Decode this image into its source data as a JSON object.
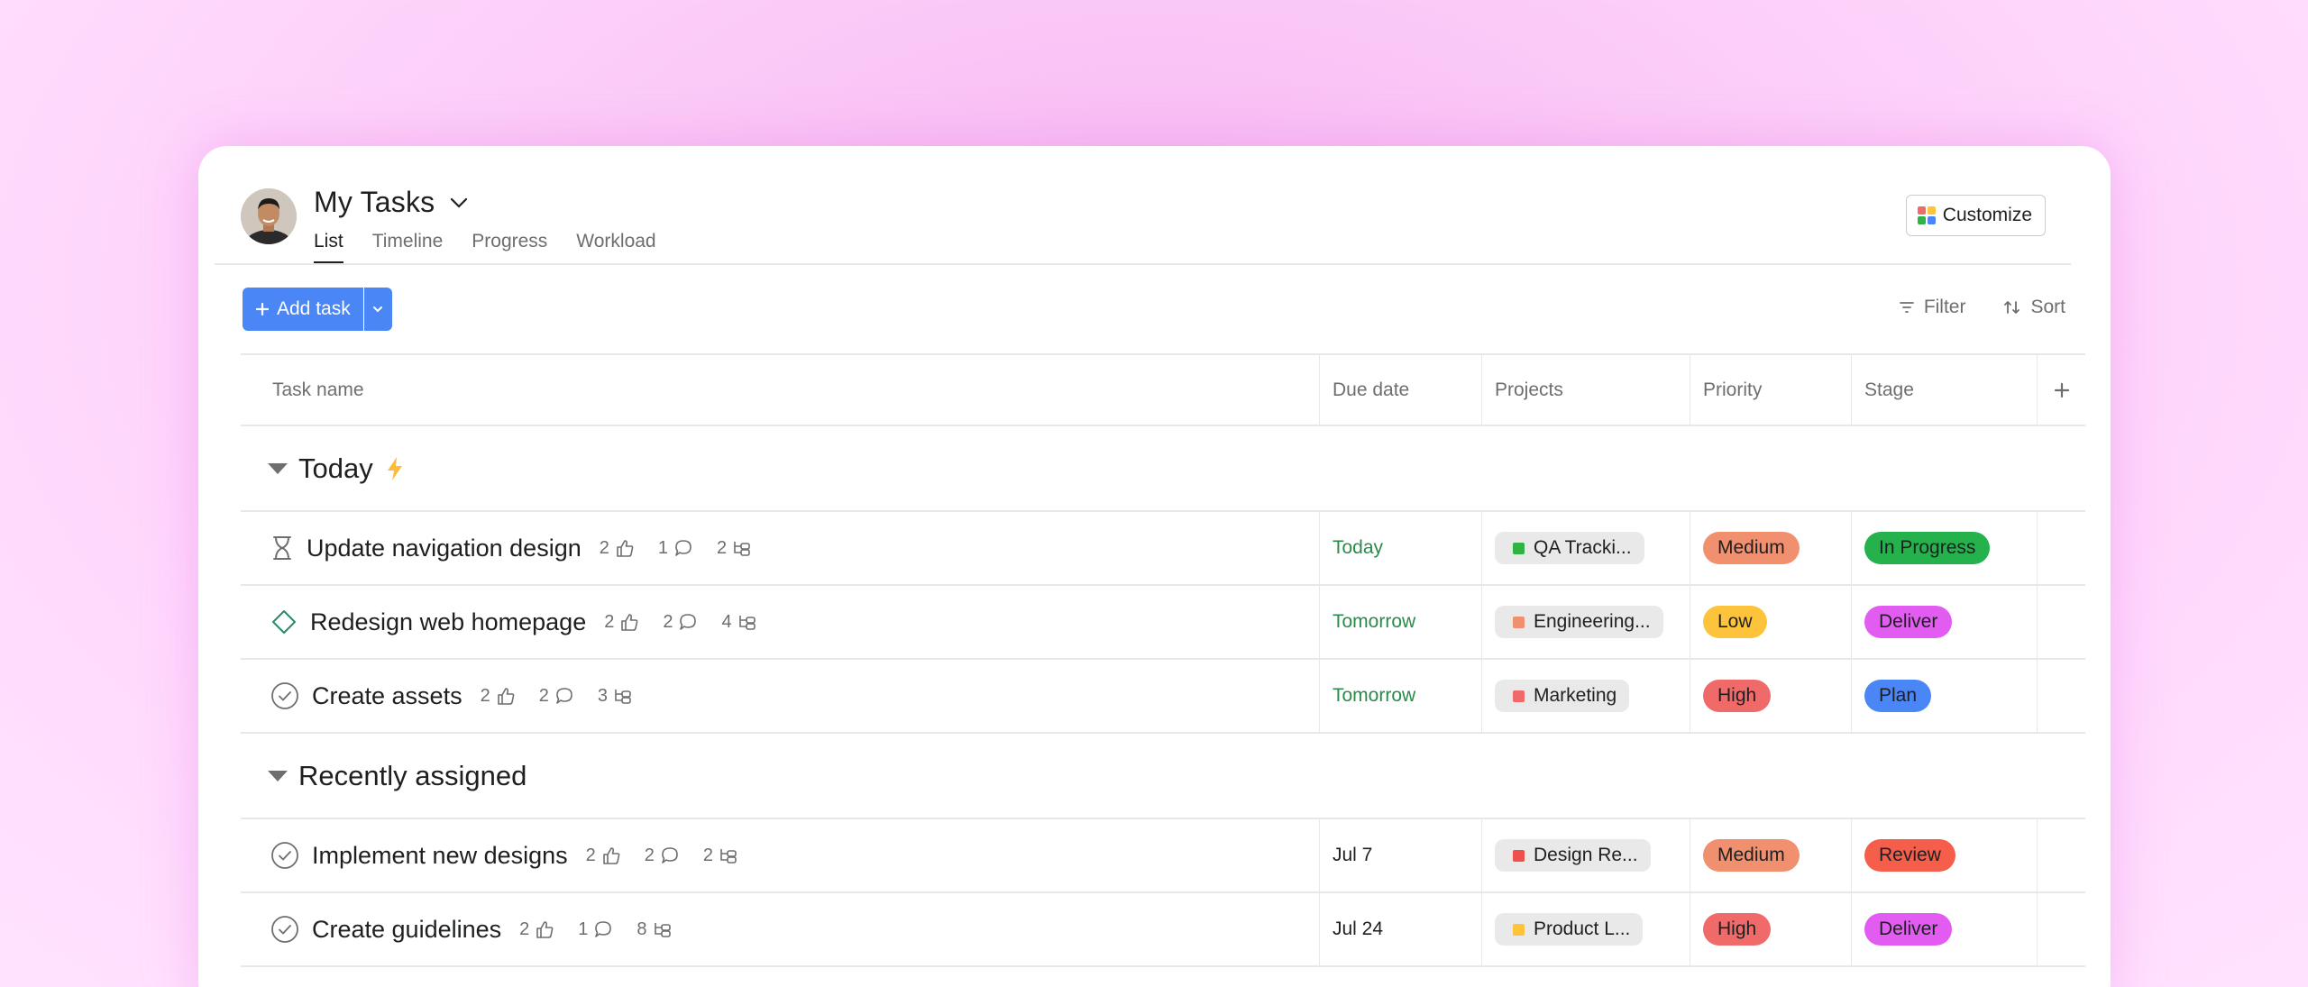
{
  "header": {
    "title": "My Tasks",
    "tabs": [
      {
        "label": "List",
        "active": true
      },
      {
        "label": "Timeline",
        "active": false
      },
      {
        "label": "Progress",
        "active": false
      },
      {
        "label": "Workload",
        "active": false
      }
    ],
    "customize_label": "Customize"
  },
  "toolbar": {
    "add_task_label": "Add task",
    "filter_label": "Filter",
    "sort_label": "Sort"
  },
  "columns": {
    "task_name": "Task name",
    "due_date": "Due date",
    "projects": "Projects",
    "priority": "Priority",
    "stage": "Stage"
  },
  "sections": [
    {
      "label": "Today",
      "icon": "lightning-icon",
      "tasks": [
        {
          "name": "Update navigation design",
          "status_icon": "hourglass-icon",
          "likes": "2",
          "comments": "1",
          "subtasks": "2",
          "due": "Today",
          "due_color": "#2a8a4a",
          "project": "QA Tracki...",
          "project_color": "#2fb344",
          "priority": "Medium",
          "priority_color": "#f0906f",
          "stage": "In Progress",
          "stage_color": "#25b14c"
        },
        {
          "name": "Redesign web homepage",
          "status_icon": "diamond-icon",
          "likes": "2",
          "comments": "2",
          "subtasks": "4",
          "due": "Tomorrow",
          "due_color": "#2a8a4a",
          "project": "Engineering...",
          "project_color": "#f0906f",
          "priority": "Low",
          "priority_color": "#fdc43b",
          "stage": "Deliver",
          "stage_color": "#e25cf1"
        },
        {
          "name": "Create assets",
          "status_icon": "check-circle-icon",
          "likes": "2",
          "comments": "2",
          "subtasks": "3",
          "due": "Tomorrow",
          "due_color": "#2a8a4a",
          "project": "Marketing",
          "project_color": "#f06a6a",
          "priority": "High",
          "priority_color": "#f06a6a",
          "stage": "Plan",
          "stage_color": "#4a86f5"
        }
      ]
    },
    {
      "label": "Recently assigned",
      "icon": "",
      "tasks": [
        {
          "name": "Implement new designs",
          "status_icon": "check-circle-icon",
          "likes": "2",
          "comments": "2",
          "subtasks": "2",
          "due": "Jul 7",
          "due_color": "#1e1f21",
          "project": "Design Re...",
          "project_color": "#f0504a",
          "priority": "Medium",
          "priority_color": "#f0906f",
          "stage": "Review",
          "stage_color": "#f45e4a"
        },
        {
          "name": "Create guidelines",
          "status_icon": "check-circle-icon",
          "likes": "2",
          "comments": "1",
          "subtasks": "8",
          "due": "Jul 24",
          "due_color": "#1e1f21",
          "project": "Product L...",
          "project_color": "#fdc43b",
          "priority": "High",
          "priority_color": "#f06a6a",
          "stage": "Deliver",
          "stage_color": "#e25cf1"
        }
      ]
    }
  ]
}
